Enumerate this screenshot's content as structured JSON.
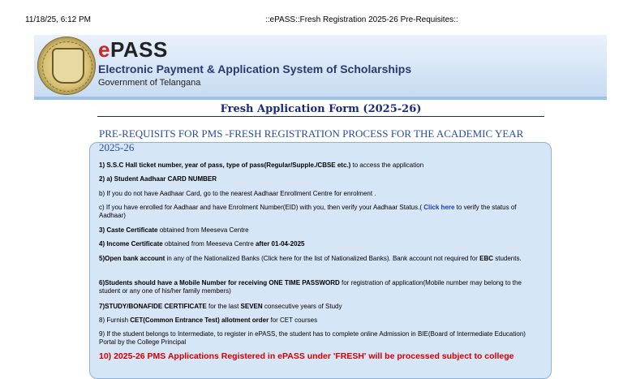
{
  "print_header": {
    "date": "11/18/25, 6:12 PM",
    "title": "::ePASS::Fresh Registration 2025-26 Pre-Requisites::"
  },
  "banner": {
    "brand_e": "e",
    "brand_rest": "PASS",
    "subtitle": "Electronic Payment & Application System of Scholarships",
    "government": "Government of Telangana",
    "seal_icon": "telangana-emblem-icon"
  },
  "form_title": "Fresh Application Form (2025-26)",
  "section_heading": "PRE-REQUISITS FOR PMS -FRESH REGISTRATION PROCESS FOR THE ACADEMIC YEAR 2025-26",
  "items": {
    "i1_bold": "1) S.S.C Hall ticket number, year of pass, type of pass(Regular/Supple./CBSE etc.)",
    "i1_rest": " to access the application",
    "i2_bold": "2) a) Student Aadhaar CARD NUMBER",
    "i2b": "b) If you do not have Aadhaar Card, go to the nearest Aadhaar Enrollment Centre for enrolment .",
    "i2c_pre": "c) If you have enrolled for Aadhaar and have Enrolment Number(EID) with you, then verify your Aadhaar Status.(",
    "i2c_link": " Click here",
    "i2c_post": " to verify the status of Aadhaar)",
    "i3_bold": "3) Caste Certificate",
    "i3_rest": " obtained from Meeseva Centre",
    "i4_bold": "4) Income Certificate",
    "i4_mid": " obtained from Meeseva Centre ",
    "i4_bold2": "after 01-04-2025",
    "i5_bold": "5)Open bank account",
    "i5_rest": " in any of the Nationalized Banks (Click here for the list of Nationalized Banks). Bank account not required for ",
    "i5_bold2": "EBC",
    "i5_end": " students.",
    "i6_bold": "6)Students should have a Mobile Number for receiving  ONE TIME PASSWORD",
    "i6_rest": " for registration of application(Mobile number may belong to the student or any one of his/her family members)",
    "i7_bold": "7)STUDY/BONAFIDE CERTIFICATE",
    "i7_mid": " for the last ",
    "i7_bold2": "SEVEN",
    "i7_end": " consecutive years of Study",
    "i8_pre": "8) Furnish ",
    "i8_bold": "CET(Common Entrance Test) allotment order",
    "i8_rest": " for CET courses",
    "i9": "9) If the student belongs to Intermediate, to register in ePASS, the student has to complete online Admission in BIE(Board of Intermediate Education) Portal by the College Principal",
    "i10": "10) 2025-26 PMS Applications Registered in ePASS under 'FRESH' will be processed subject to college"
  }
}
